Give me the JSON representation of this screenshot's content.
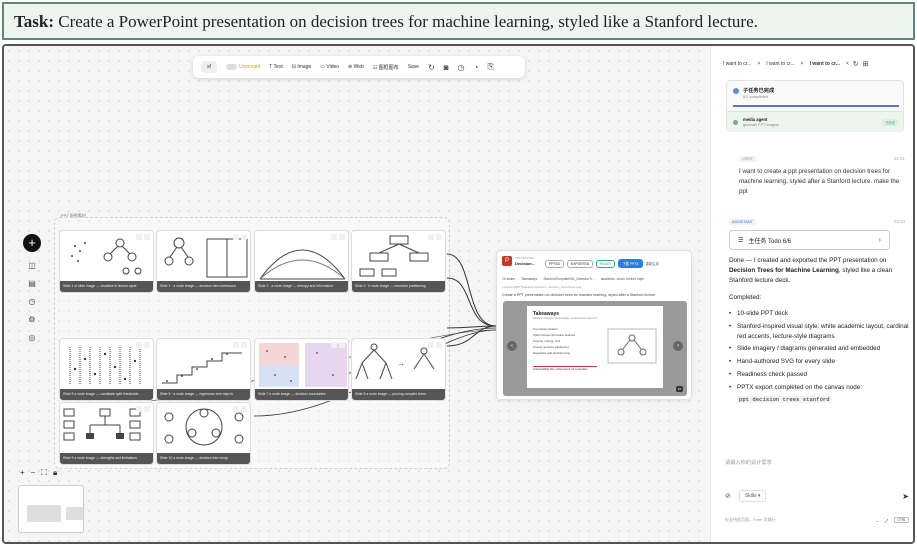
{
  "task": {
    "label": "Task:",
    "text": "Create a PowerPoint presentation on decision trees for machine learning, styled like a Stanford lecture."
  },
  "toolbar": {
    "selector": "sf",
    "toggle_label": "Unpinned",
    "items": [
      "T Text",
      "⊟ Image",
      "▭ Video",
      "⊕ Web",
      "☷ 图框图布"
    ],
    "save": "Save"
  },
  "group_label": "PPT 配图素材",
  "cards": [
    "Slide 1 of slide image — visualize in lesson cycle",
    "Slide 1 · a route image — decision tree continuous",
    "Slide 2 · a route image — entropy and information",
    "Slide 3 · b route image — recursive partitioning",
    "Slide 5 a route image — candidate split thresholds",
    "Slide 5 · a route image — regression tree step fu",
    "Slide 7 a route image — decision boundaries",
    "Slide 8 a route image — pruning complex trees",
    "Slide 9 a route image — strengths and limitations",
    "Slide 10 a route image — decision tree recap"
  ],
  "ppt": {
    "kicker": "PPT MASTER",
    "title": "Decision...",
    "tag1": "PPTSD",
    "tag2": "EXPORTED",
    "tag3": "READY",
    "button": "下载 PPTX",
    "button2": "重新生成",
    "row": [
      "10 slides",
      "Takeaways",
      "StanfordTemplate/ML_DecisionTr...",
      "academic, clean, lecture style"
    ],
    "path": "~/stanford/PPTMaster/projects/ml_decision_trees/deck.pptx",
    "desc": "Create a PPT presentation on decision trees for machine learning, styled after a Stanford lecture.",
    "slide_title": "Takeaways",
    "slide_sub": "Decision trees are interpretable, nonparametric learners",
    "slide_bullets": [
      "Tree basics intuition",
      "Splits choose informative features",
      "Impurity: entropy, Gini",
      "Greedy recursive partitioning",
      "Regularize with depth/pruning"
    ],
    "slide_note": "Interpretability first, performance via ensembles",
    "page": "10"
  },
  "panel": {
    "tabs": [
      "I want to cr...",
      "I want to cr...",
      "I want to cr..."
    ],
    "subtask_title": "子任务已完成",
    "subtask_sub": "0/1 completed",
    "agent_title": "media agent",
    "agent_sub": "generate PPT imagery",
    "agent_badge": "已完成",
    "user_tag": "USER",
    "user_time": "01:51",
    "user_msg": "I want to create a ppt presentation on decision trees for machine learning, styled after a Stanford lecture. make the ppt",
    "assistant_tag": "ASSISTANT",
    "assistant_time": "02:24",
    "todo": "主任务 Todo 6/6",
    "done_pre": "Done — I created and exported the PPT presentation on ",
    "done_bold": "Decision Trees for Machine Learning",
    "done_post": ", styled like a clean Stanford lecture deck.",
    "completed": "Completed:",
    "bullets": [
      "10-slide PPT deck",
      "Stanford-inspired visual style: white academic layout, cardinal red accents, lecture-style diagrams",
      "Slide imagery / diagrams generated and embedded",
      "Hand-authored SVG for every slide",
      "Readiness check passed",
      "PPTX export completed on the canvas node:"
    ],
    "code": "ppt decision trees stanford",
    "input_placeholder": "请输入你的设计需求",
    "skills": "Skills",
    "footer_hint": "仅支持此页面，Enter 可换行",
    "footer_key": "CTRL"
  }
}
